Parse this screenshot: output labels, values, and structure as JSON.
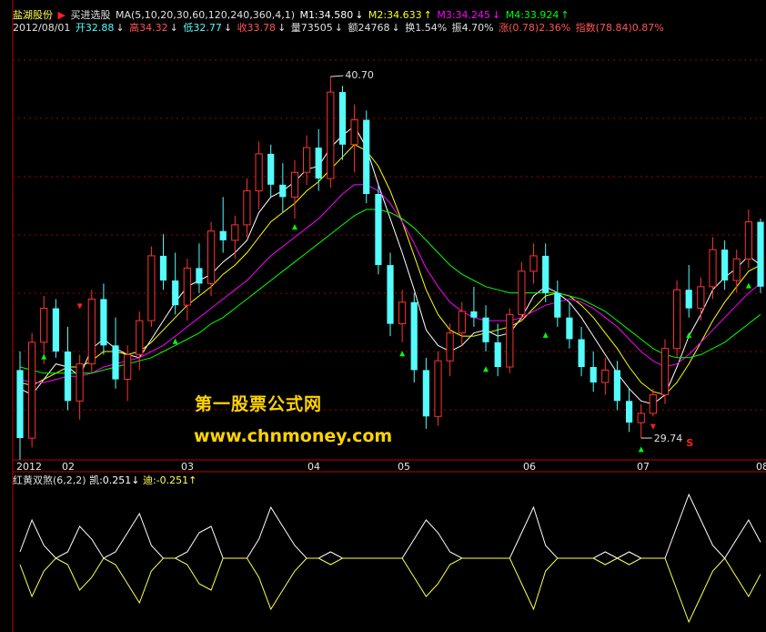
{
  "header": {
    "stock_name": "盐湖股份",
    "formula": "买进选股",
    "ma_text": "MA(5,10,20,30,60,120,240,360,4,1)",
    "m1": "M1:34.580",
    "m1_arrow": "↓",
    "m2": "M2:34.633",
    "m2_arrow": "↑",
    "m3": "M3:34.245",
    "m3_arrow": "↓",
    "m4": "M4:33.924",
    "m4_arrow": "↑",
    "date": "2012/08/01",
    "open": "开32.88",
    "open_arrow": "↓",
    "high": "高34.32",
    "high_arrow": "↓",
    "low": "低32.77",
    "low_arrow": "↓",
    "close": "收33.78",
    "close_arrow": "↓",
    "volume": "量73505",
    "volume_arrow": "↓",
    "amount": "额24768",
    "amount_arrow": "↓",
    "turnover": "换1.54%",
    "amplitude": "振4.70%",
    "change": "涨(0.78)2.36%",
    "index": "指数(78.84)0.87%"
  },
  "watermark": {
    "line1": "第一股票公式网",
    "line2": "www.chnmoney.com"
  },
  "indicator": {
    "name": "红黄双煞(6,2,2)",
    "kai": "凯:0.251",
    "kai_arrow": "↓",
    "di": "迪:-0.251",
    "di_arrow": "↑"
  },
  "colors": {
    "up": "#ff3232",
    "down": "#54fcfc",
    "m1": "#ffffff",
    "m2": "#ffff00",
    "m3": "#ff00ff",
    "m4": "#00ff00",
    "grid": "#a00000",
    "signal_buy": "#00ff00",
    "signal_sell": "#ff2020"
  },
  "chart_data": {
    "type": "line",
    "title": "",
    "x_ticks": [
      "2012",
      "02",
      "03",
      "04",
      "05",
      "06",
      "07",
      "08"
    ],
    "price_labels": {
      "high": "40.70",
      "low": "29.74",
      "signal": "S"
    },
    "price_range": [
      28.5,
      42.0
    ],
    "candles_ohlc": [
      [
        31.2,
        31.8,
        28.3,
        29.0
      ],
      [
        29.0,
        32.4,
        28.7,
        32.1
      ],
      [
        32.1,
        33.6,
        31.4,
        33.2
      ],
      [
        33.2,
        33.5,
        31.6,
        31.8
      ],
      [
        31.8,
        32.6,
        29.9,
        30.2
      ],
      [
        30.2,
        31.7,
        29.6,
        31.4
      ],
      [
        31.4,
        33.8,
        31.1,
        33.5
      ],
      [
        33.5,
        34.0,
        31.7,
        32.0
      ],
      [
        32.0,
        32.9,
        30.6,
        30.9
      ],
      [
        30.9,
        32.0,
        30.2,
        31.7
      ],
      [
        31.7,
        33.1,
        31.2,
        32.8
      ],
      [
        32.8,
        35.2,
        32.6,
        34.9
      ],
      [
        34.9,
        35.6,
        33.8,
        34.1
      ],
      [
        34.1,
        35.0,
        33.0,
        33.3
      ],
      [
        33.3,
        34.8,
        32.8,
        34.5
      ],
      [
        34.5,
        35.3,
        33.7,
        34.0
      ],
      [
        34.0,
        36.0,
        33.6,
        35.7
      ],
      [
        35.7,
        36.8,
        35.0,
        35.4
      ],
      [
        35.4,
        36.2,
        34.8,
        35.9
      ],
      [
        35.9,
        37.4,
        35.5,
        37.0
      ],
      [
        37.0,
        38.6,
        36.4,
        38.2
      ],
      [
        38.2,
        38.5,
        36.8,
        37.2
      ],
      [
        37.2,
        37.9,
        36.3,
        36.8
      ],
      [
        36.8,
        38.0,
        36.1,
        37.6
      ],
      [
        37.6,
        38.8,
        37.2,
        38.4
      ],
      [
        38.4,
        39.0,
        37.0,
        37.4
      ],
      [
        37.4,
        40.7,
        37.1,
        40.2
      ],
      [
        40.2,
        40.4,
        38.0,
        38.5
      ],
      [
        38.5,
        39.8,
        37.6,
        39.3
      ],
      [
        39.3,
        39.6,
        36.6,
        36.9
      ],
      [
        36.9,
        37.2,
        34.3,
        34.6
      ],
      [
        34.6,
        35.0,
        32.3,
        32.7
      ],
      [
        32.7,
        33.8,
        32.1,
        33.4
      ],
      [
        33.4,
        33.7,
        30.8,
        31.2
      ],
      [
        31.2,
        31.6,
        29.3,
        29.7
      ],
      [
        29.7,
        31.8,
        29.4,
        31.5
      ],
      [
        31.5,
        32.7,
        31.0,
        32.4
      ],
      [
        32.4,
        33.4,
        32.0,
        33.1
      ],
      [
        33.1,
        33.9,
        32.6,
        32.9
      ],
      [
        32.9,
        33.3,
        31.8,
        32.1
      ],
      [
        32.1,
        32.7,
        31.0,
        31.3
      ],
      [
        31.3,
        33.2,
        31.1,
        33.0
      ],
      [
        33.0,
        34.7,
        32.8,
        34.4
      ],
      [
        34.4,
        35.3,
        34.0,
        34.9
      ],
      [
        34.9,
        35.3,
        33.4,
        33.7
      ],
      [
        33.7,
        34.1,
        32.6,
        32.9
      ],
      [
        32.9,
        33.4,
        31.9,
        32.2
      ],
      [
        32.2,
        32.6,
        31.0,
        31.3
      ],
      [
        31.3,
        31.8,
        30.5,
        30.8
      ],
      [
        30.8,
        31.6,
        30.4,
        31.2
      ],
      [
        31.2,
        31.5,
        29.9,
        30.2
      ],
      [
        30.2,
        30.6,
        29.2,
        29.5
      ],
      [
        29.5,
        30.1,
        29.0,
        29.8
      ],
      [
        29.8,
        30.6,
        29.7,
        30.4
      ],
      [
        30.4,
        32.2,
        30.1,
        31.9
      ],
      [
        31.9,
        34.1,
        31.6,
        33.8
      ],
      [
        33.8,
        34.6,
        32.9,
        33.2
      ],
      [
        33.2,
        34.2,
        32.8,
        33.9
      ],
      [
        33.9,
        35.5,
        33.5,
        35.1
      ],
      [
        35.1,
        35.4,
        33.8,
        34.1
      ],
      [
        34.1,
        35.1,
        33.7,
        34.8
      ],
      [
        34.8,
        36.4,
        34.5,
        36.0
      ],
      [
        36.0,
        36.1,
        33.7,
        33.9
      ]
    ],
    "ma_series": [
      {
        "name": "M1",
        "values": [
          30.6,
          30.4,
          30.9,
          31.4,
          31.3,
          31.0,
          31.9,
          32.2,
          31.9,
          31.7,
          31.6,
          32.2,
          32.8,
          33.4,
          33.9,
          34.1,
          34.3,
          34.7,
          35.0,
          35.4,
          36.3,
          36.8,
          37.0,
          37.3,
          37.7,
          37.8,
          38.4,
          38.8,
          39.1,
          38.4,
          37.2,
          36.1,
          35.0,
          33.8,
          32.5,
          32.0,
          31.8,
          32.0,
          32.4,
          32.5,
          32.3,
          32.4,
          32.9,
          33.6,
          33.9,
          33.7,
          33.4,
          32.9,
          32.3,
          31.7,
          31.1,
          30.6,
          30.2,
          30.1,
          30.4,
          31.3,
          32.3,
          33.0,
          33.8,
          34.2,
          34.5,
          34.9,
          34.6
        ]
      },
      {
        "name": "M2",
        "values": [
          30.8,
          30.7,
          30.9,
          31.1,
          31.3,
          31.3,
          31.5,
          31.8,
          31.8,
          31.7,
          31.8,
          32.1,
          32.5,
          32.9,
          33.3,
          33.6,
          33.9,
          34.3,
          34.6,
          35.0,
          35.5,
          36.0,
          36.3,
          36.6,
          37.0,
          37.3,
          37.7,
          38.1,
          38.5,
          38.3,
          37.8,
          37.0,
          36.0,
          34.9,
          33.8,
          33.0,
          32.5,
          32.3,
          32.3,
          32.4,
          32.5,
          32.6,
          32.8,
          33.2,
          33.6,
          33.7,
          33.6,
          33.3,
          32.9,
          32.4,
          31.9,
          31.3,
          30.8,
          30.5,
          30.4,
          30.8,
          31.4,
          32.1,
          32.8,
          33.4,
          33.9,
          34.4,
          34.6
        ]
      },
      {
        "name": "M3",
        "values": [
          30.9,
          30.8,
          30.8,
          30.9,
          31.0,
          31.0,
          31.1,
          31.3,
          31.4,
          31.5,
          31.6,
          31.8,
          32.0,
          32.3,
          32.6,
          32.9,
          33.2,
          33.5,
          33.8,
          34.1,
          34.5,
          34.9,
          35.2,
          35.5,
          35.8,
          36.1,
          36.5,
          36.9,
          37.2,
          37.2,
          37.0,
          36.6,
          36.0,
          35.3,
          34.5,
          33.9,
          33.4,
          33.1,
          32.9,
          32.8,
          32.8,
          32.8,
          32.9,
          33.1,
          33.3,
          33.4,
          33.5,
          33.4,
          33.2,
          32.9,
          32.6,
          32.2,
          31.8,
          31.5,
          31.3,
          31.4,
          31.7,
          32.1,
          32.5,
          32.9,
          33.3,
          33.7,
          34.0
        ]
      },
      {
        "name": "M4",
        "values": [
          31.3,
          31.2,
          31.1,
          31.1,
          31.1,
          31.1,
          31.1,
          31.2,
          31.3,
          31.4,
          31.5,
          31.6,
          31.8,
          32.0,
          32.2,
          32.4,
          32.7,
          32.9,
          33.2,
          33.5,
          33.8,
          34.1,
          34.4,
          34.7,
          35.0,
          35.3,
          35.6,
          35.9,
          36.2,
          36.4,
          36.4,
          36.3,
          36.1,
          35.8,
          35.4,
          35.0,
          34.6,
          34.3,
          34.1,
          33.9,
          33.8,
          33.7,
          33.7,
          33.7,
          33.7,
          33.7,
          33.6,
          33.5,
          33.3,
          33.1,
          32.8,
          32.5,
          32.2,
          31.9,
          31.7,
          31.6,
          31.6,
          31.7,
          31.9,
          32.1,
          32.4,
          32.7,
          33.0
        ]
      }
    ],
    "indicator_series": [
      {
        "name": "凯",
        "values": [
          0.1,
          0.6,
          0.2,
          0.0,
          0.1,
          0.5,
          0.3,
          0.0,
          0.1,
          0.4,
          0.7,
          0.2,
          0.0,
          0.0,
          0.1,
          0.4,
          0.5,
          0.0,
          0.0,
          0.0,
          0.3,
          0.8,
          0.5,
          0.2,
          0.0,
          0.0,
          0.1,
          0.0,
          0.0,
          0.0,
          0.0,
          0.0,
          0.0,
          0.3,
          0.6,
          0.4,
          0.1,
          0.0,
          0.0,
          0.0,
          0.0,
          0.0,
          0.4,
          0.8,
          0.2,
          0.0,
          0.0,
          0.0,
          0.0,
          0.1,
          0.0,
          0.1,
          0.0,
          0.0,
          0.0,
          0.5,
          1.0,
          0.6,
          0.2,
          0.0,
          0.3,
          0.6,
          0.251
        ]
      },
      {
        "name": "迪",
        "values": [
          -0.1,
          -0.6,
          -0.2,
          0.0,
          -0.1,
          -0.5,
          -0.3,
          0.0,
          -0.1,
          -0.4,
          -0.7,
          -0.2,
          0.0,
          0.0,
          -0.1,
          -0.4,
          -0.5,
          0.0,
          0.0,
          0.0,
          -0.3,
          -0.8,
          -0.5,
          -0.2,
          0.0,
          0.0,
          -0.1,
          0.0,
          0.0,
          0.0,
          0.0,
          0.0,
          0.0,
          -0.3,
          -0.6,
          -0.4,
          -0.1,
          0.0,
          0.0,
          0.0,
          0.0,
          0.0,
          -0.4,
          -0.8,
          -0.2,
          0.0,
          0.0,
          0.0,
          0.0,
          -0.1,
          0.0,
          -0.1,
          0.0,
          0.0,
          0.0,
          -0.5,
          -1.0,
          -0.6,
          -0.2,
          0.0,
          -0.3,
          -0.6,
          -0.251
        ]
      }
    ],
    "indicator_range": [
      -1.1,
      1.1
    ]
  }
}
